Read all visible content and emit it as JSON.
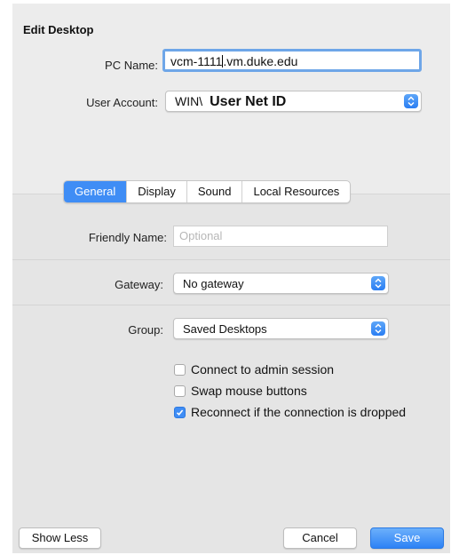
{
  "dialog": {
    "title": "Edit Desktop",
    "pc_name_label": "PC Name:",
    "pc_name_value_before_caret": "vcm-1111",
    "pc_name_value_after_caret": ".vm.duke.edu",
    "user_account_label": "User Account:",
    "user_account_prefix": "WIN\\",
    "user_account_value": "User Net ID"
  },
  "tabs": [
    "General",
    "Display",
    "Sound",
    "Local Resources"
  ],
  "general": {
    "friendly_name_label": "Friendly Name:",
    "friendly_name_placeholder": "Optional",
    "gateway_label": "Gateway:",
    "gateway_value": "No gateway",
    "group_label": "Group:",
    "group_value": "Saved Desktops",
    "options": [
      {
        "label": "Connect to admin session",
        "checked": false
      },
      {
        "label": "Swap mouse buttons",
        "checked": false
      },
      {
        "label": "Reconnect if the connection is dropped",
        "checked": true
      }
    ]
  },
  "buttons": {
    "show_less": "Show Less",
    "cancel": "Cancel",
    "save": "Save"
  },
  "colors": {
    "accent": "#3f8df5",
    "focus_ring": "#6ea6e8",
    "panel_bg": "#ececec"
  },
  "icons": {
    "popup_stepper": "chevron-up-down-icon",
    "checkmark": "checkmark-icon"
  }
}
